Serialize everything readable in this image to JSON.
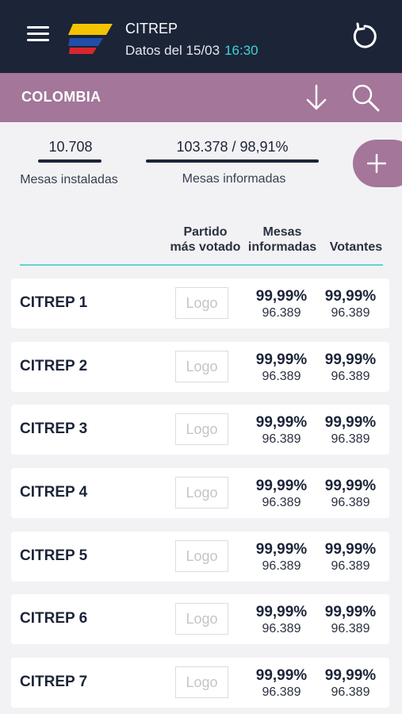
{
  "header": {
    "app_title": "CITREP",
    "subtitle": "Datos del 15/03",
    "time": "16:30",
    "icons": {
      "menu": "hamburger-menu-icon",
      "refresh": "refresh-icon",
      "logo": "colombia-flag-logo"
    },
    "colors": {
      "header_bg": "#1c2438",
      "accent": "#3dd6d6"
    }
  },
  "region": {
    "name": "COLOMBIA",
    "icons": {
      "download": "arrow-down-icon",
      "search": "search-icon"
    },
    "color": "#a3769a"
  },
  "stats": {
    "mesas_instaladas_value": "10.708",
    "mesas_instaladas_label": "Mesas instaladas",
    "mesas_informadas_value": "103.378 / 98,91%",
    "mesas_informadas_label": "Mesas informadas",
    "add_icon": "plus-icon"
  },
  "table": {
    "headers": {
      "partido_line1": "Partido",
      "partido_line2": "más votado",
      "mesas_line1": "Mesas",
      "mesas_line2": "informadas",
      "votantes": "Votantes"
    },
    "rows": [
      {
        "name": "CITREP 1",
        "logo": "Logo",
        "mesas_pct": "99,99%",
        "mesas_count": "96.389",
        "votantes_pct": "99,99%",
        "votantes_count": "96.389"
      },
      {
        "name": "CITREP 2",
        "logo": "Logo",
        "mesas_pct": "99,99%",
        "mesas_count": "96.389",
        "votantes_pct": "99,99%",
        "votantes_count": "96.389"
      },
      {
        "name": "CITREP 3",
        "logo": "Logo",
        "mesas_pct": "99,99%",
        "mesas_count": "96.389",
        "votantes_pct": "99,99%",
        "votantes_count": "96.389"
      },
      {
        "name": "CITREP 4",
        "logo": "Logo",
        "mesas_pct": "99,99%",
        "mesas_count": "96.389",
        "votantes_pct": "99,99%",
        "votantes_count": "96.389"
      },
      {
        "name": "CITREP 5",
        "logo": "Logo",
        "mesas_pct": "99,99%",
        "mesas_count": "96.389",
        "votantes_pct": "99,99%",
        "votantes_count": "96.389"
      },
      {
        "name": "CITREP 6",
        "logo": "Logo",
        "mesas_pct": "99,99%",
        "mesas_count": "96.389",
        "votantes_pct": "99,99%",
        "votantes_count": "96.389"
      },
      {
        "name": "CITREP 7",
        "logo": "Logo",
        "mesas_pct": "99,99%",
        "mesas_count": "96.389",
        "votantes_pct": "99,99%",
        "votantes_count": "96.389"
      }
    ]
  }
}
